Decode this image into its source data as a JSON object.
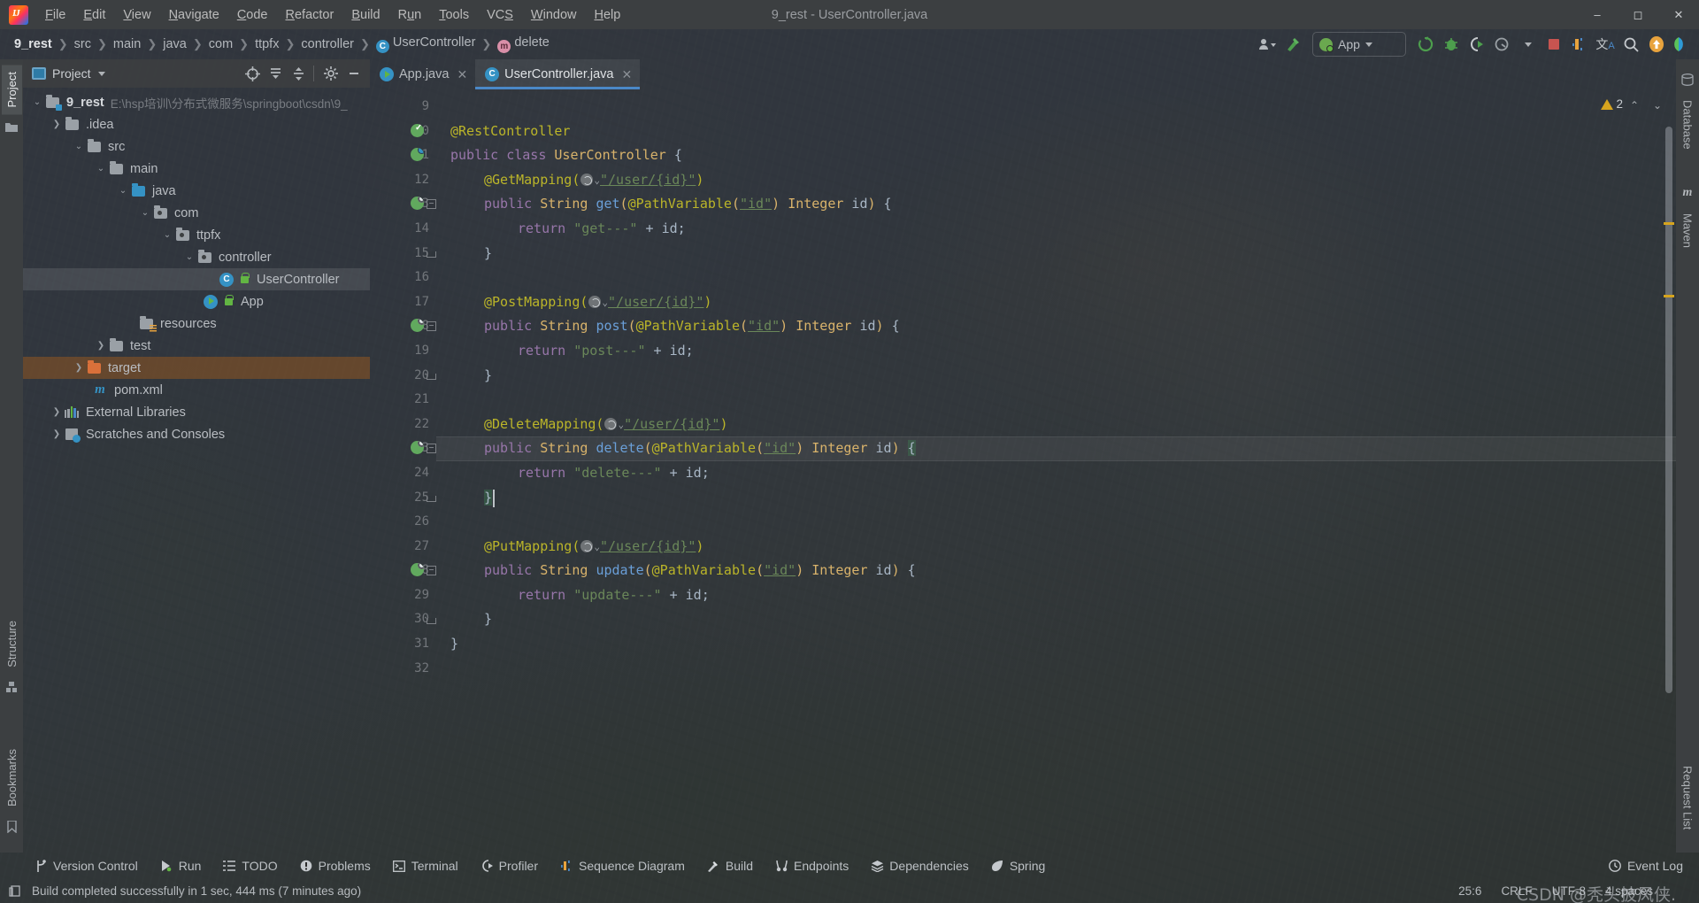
{
  "window": {
    "title": "9_rest - UserController.java",
    "minimize": "‒",
    "maximize": "▢",
    "close": "✕"
  },
  "menu": [
    {
      "label": "File"
    },
    {
      "label": "Edit"
    },
    {
      "label": "View"
    },
    {
      "label": "Navigate"
    },
    {
      "label": "Code"
    },
    {
      "label": "Refactor"
    },
    {
      "label": "Build"
    },
    {
      "label": "Run"
    },
    {
      "label": "Tools"
    },
    {
      "label": "VCS"
    },
    {
      "label": "Window"
    },
    {
      "label": "Help"
    }
  ],
  "breadcrumb": {
    "items": [
      "9_rest",
      "src",
      "main",
      "java",
      "com",
      "ttpfx",
      "controller",
      "UserController",
      "delete"
    ],
    "separator": "❯",
    "class_icon": "C",
    "method_icon": "m"
  },
  "toolbar": {
    "run_config": "App",
    "items": [
      {
        "name": "user-settings",
        "glyph": "👤"
      },
      {
        "name": "build-hammer",
        "glyph": "🔨"
      },
      {
        "name": "rerun",
        "glyph": "⟳"
      },
      {
        "name": "debug",
        "glyph": "🐞"
      },
      {
        "name": "run-with-coverage",
        "glyph": "▶"
      },
      {
        "name": "profiler",
        "glyph": "◑"
      },
      {
        "name": "stop",
        "glyph": "■"
      },
      {
        "name": "sequence-diagram",
        "glyph": "❙"
      },
      {
        "name": "translate",
        "glyph": "文A"
      },
      {
        "name": "search-everywhere",
        "glyph": "🔍"
      },
      {
        "name": "update-available",
        "glyph": "↑"
      },
      {
        "name": "ide-feature",
        "glyph": "◗"
      }
    ]
  },
  "project_panel": {
    "title": "Project",
    "header_buttons": [
      {
        "name": "select-opened-file",
        "glyph": "⊕"
      },
      {
        "name": "expand-all",
        "glyph": "⤓"
      },
      {
        "name": "collapse-all",
        "glyph": "⤒"
      },
      {
        "name": "settings",
        "glyph": "⚙"
      },
      {
        "name": "hide",
        "glyph": "—"
      }
    ],
    "tree": [
      {
        "label": "9_rest",
        "path": "E:\\hsp培训\\分布式微服务\\springboot\\csdn\\9_",
        "indent": 0,
        "arrow": "⌄",
        "icon": "folder-module",
        "bold": true
      },
      {
        "label": ".idea",
        "indent": 1,
        "arrow": "❯",
        "icon": "folder"
      },
      {
        "label": "src",
        "indent": 1,
        "arrow": "⌄",
        "icon": "folder"
      },
      {
        "label": "main",
        "indent": 2,
        "arrow": "⌄",
        "icon": "folder"
      },
      {
        "label": "java",
        "indent": 3,
        "arrow": "⌄",
        "icon": "folder-source"
      },
      {
        "label": "com",
        "indent": 4,
        "arrow": "⌄",
        "icon": "folder-package"
      },
      {
        "label": "ttpfx",
        "indent": 5,
        "arrow": "⌄",
        "icon": "folder-package"
      },
      {
        "label": "controller",
        "indent": 6,
        "arrow": "⌄",
        "icon": "folder-package"
      },
      {
        "label": "UserController",
        "indent": 7,
        "arrow": "",
        "icon": "java-class",
        "selected": true
      },
      {
        "label": "App",
        "indent": 6,
        "arrow": "",
        "icon": "java-runnable-class"
      },
      {
        "label": "resources",
        "indent": 4,
        "arrow": "",
        "icon": "folder-resources"
      },
      {
        "label": "test",
        "indent": 3,
        "arrow": "❯",
        "icon": "folder"
      },
      {
        "label": "target",
        "indent": 1,
        "arrow": "❯",
        "icon": "folder-excluded",
        "target": true
      },
      {
        "label": "pom.xml",
        "indent": 1,
        "arrow": "",
        "icon": "maven"
      },
      {
        "label": "External Libraries",
        "indent": 0,
        "arrow": "❯",
        "icon": "libraries"
      },
      {
        "label": "Scratches and Consoles",
        "indent": 0,
        "arrow": "❯",
        "icon": "scratches"
      }
    ]
  },
  "left_strip": [
    {
      "label": "Project",
      "active": true
    },
    {
      "label": "Structure",
      "active": false
    },
    {
      "label": "Bookmarks",
      "active": false
    }
  ],
  "right_strip": [
    {
      "label": "Database"
    },
    {
      "label": "Maven"
    },
    {
      "label": "Request List"
    }
  ],
  "editor": {
    "tabs": [
      {
        "label": "App.java",
        "icon": "java-runnable-class",
        "active": false,
        "close": "✕"
      },
      {
        "label": "UserController.java",
        "icon": "java-class",
        "active": true,
        "close": "✕"
      }
    ],
    "warning_count": "2",
    "nav_up": "⌃",
    "nav_down": "⌄",
    "first_line_number": 9,
    "lines": [
      {
        "n": 9,
        "text": ""
      },
      {
        "n": 10,
        "text": "@RestController",
        "indent": 0,
        "marker": "bean-check",
        "tokens": [
          {
            "t": "@RestController",
            "c": "an"
          }
        ]
      },
      {
        "n": 11,
        "text": "public class UserController {",
        "indent": 0,
        "marker": "bean-class",
        "tokens": [
          {
            "t": "public",
            "c": "kw"
          },
          {
            "t": " ",
            "c": "op"
          },
          {
            "t": "class",
            "c": "kw"
          },
          {
            "t": " ",
            "c": "op"
          },
          {
            "t": "UserController",
            "c": "ty"
          },
          {
            "t": " {",
            "c": "op"
          }
        ]
      },
      {
        "n": 12,
        "text": "@GetMapping(\"/user/{id}\")",
        "indent": 1,
        "tokens": [
          {
            "t": "@GetMapping(",
            "c": "an"
          },
          {
            "t": "WEB",
            "c": "web"
          },
          {
            "t": "\"/user/{id}\"",
            "c": "st-ul"
          },
          {
            "t": ")",
            "c": "an"
          }
        ]
      },
      {
        "n": 13,
        "text": "public String get(@PathVariable(\"id\") Integer id) {",
        "indent": 1,
        "marker": "bean-web",
        "fold": "collapse",
        "tokens": [
          {
            "t": "public",
            "c": "kw"
          },
          {
            "t": " ",
            "c": "op"
          },
          {
            "t": "String",
            "c": "ty"
          },
          {
            "t": " ",
            "c": "op"
          },
          {
            "t": "get",
            "c": "mn"
          },
          {
            "t": "(",
            "c": "par"
          },
          {
            "t": "@PathVariable",
            "c": "an"
          },
          {
            "t": "(",
            "c": "par"
          },
          {
            "t": "\"id\"",
            "c": "st-ul"
          },
          {
            "t": ")",
            "c": "par"
          },
          {
            "t": " ",
            "c": "op"
          },
          {
            "t": "Integer",
            "c": "ty"
          },
          {
            "t": " id",
            "c": "pn"
          },
          {
            "t": ")",
            "c": "par"
          },
          {
            "t": " {",
            "c": "op"
          }
        ]
      },
      {
        "n": 14,
        "text": "return \"get---\" + id;",
        "indent": 2,
        "tokens": [
          {
            "t": "return",
            "c": "kw"
          },
          {
            "t": " ",
            "c": "op"
          },
          {
            "t": "\"get---\"",
            "c": "st"
          },
          {
            "t": " + ",
            "c": "op"
          },
          {
            "t": "id",
            "c": "pn"
          },
          {
            "t": ";",
            "c": "op"
          }
        ]
      },
      {
        "n": 15,
        "text": "}",
        "indent": 1,
        "fold": "end",
        "tokens": [
          {
            "t": "}",
            "c": "op"
          }
        ]
      },
      {
        "n": 16,
        "text": ""
      },
      {
        "n": 17,
        "text": "@PostMapping(\"/user/{id}\")",
        "indent": 1,
        "tokens": [
          {
            "t": "@PostMapping(",
            "c": "an"
          },
          {
            "t": "WEB",
            "c": "web"
          },
          {
            "t": "\"/user/{id}\"",
            "c": "st-ul"
          },
          {
            "t": ")",
            "c": "an"
          }
        ]
      },
      {
        "n": 18,
        "text": "public String post(@PathVariable(\"id\") Integer id) {",
        "indent": 1,
        "marker": "bean-web",
        "fold": "collapse",
        "tokens": [
          {
            "t": "public",
            "c": "kw"
          },
          {
            "t": " ",
            "c": "op"
          },
          {
            "t": "String",
            "c": "ty"
          },
          {
            "t": " ",
            "c": "op"
          },
          {
            "t": "post",
            "c": "mn"
          },
          {
            "t": "(",
            "c": "par"
          },
          {
            "t": "@PathVariable",
            "c": "an"
          },
          {
            "t": "(",
            "c": "par"
          },
          {
            "t": "\"id\"",
            "c": "st-ul"
          },
          {
            "t": ")",
            "c": "par"
          },
          {
            "t": " ",
            "c": "op"
          },
          {
            "t": "Integer",
            "c": "ty"
          },
          {
            "t": " id",
            "c": "pn"
          },
          {
            "t": ")",
            "c": "par"
          },
          {
            "t": " {",
            "c": "op"
          }
        ]
      },
      {
        "n": 19,
        "text": "return \"post---\" + id;",
        "indent": 2,
        "tokens": [
          {
            "t": "return",
            "c": "kw"
          },
          {
            "t": " ",
            "c": "op"
          },
          {
            "t": "\"post---\"",
            "c": "st"
          },
          {
            "t": " + ",
            "c": "op"
          },
          {
            "t": "id",
            "c": "pn"
          },
          {
            "t": ";",
            "c": "op"
          }
        ]
      },
      {
        "n": 20,
        "text": "}",
        "indent": 1,
        "fold": "end",
        "tokens": [
          {
            "t": "}",
            "c": "op"
          }
        ]
      },
      {
        "n": 21,
        "text": ""
      },
      {
        "n": 22,
        "text": "@DeleteMapping(\"/user/{id}\")",
        "indent": 1,
        "tokens": [
          {
            "t": "@DeleteMapping(",
            "c": "an"
          },
          {
            "t": "WEB",
            "c": "web"
          },
          {
            "t": "\"/user/{id}\"",
            "c": "st-ul"
          },
          {
            "t": ")",
            "c": "an"
          }
        ]
      },
      {
        "n": 23,
        "text": "public String delete(@PathVariable(\"id\") Integer id) {",
        "indent": 1,
        "marker": "bean-web",
        "fold": "collapse",
        "highlight": true,
        "tokens": [
          {
            "t": "public",
            "c": "kw"
          },
          {
            "t": " ",
            "c": "op"
          },
          {
            "t": "String",
            "c": "ty"
          },
          {
            "t": " ",
            "c": "op"
          },
          {
            "t": "delete",
            "c": "mn"
          },
          {
            "t": "(",
            "c": "par"
          },
          {
            "t": "@PathVariable",
            "c": "an"
          },
          {
            "t": "(",
            "c": "par"
          },
          {
            "t": "\"id\"",
            "c": "st-ul"
          },
          {
            "t": ")",
            "c": "par"
          },
          {
            "t": " ",
            "c": "op"
          },
          {
            "t": "Integer",
            "c": "ty"
          },
          {
            "t": " id",
            "c": "pn"
          },
          {
            "t": ")",
            "c": "par"
          },
          {
            "t": " ",
            "c": "op"
          },
          {
            "t": "{",
            "c": "brace"
          }
        ]
      },
      {
        "n": 24,
        "text": "return \"delete---\" + id;",
        "indent": 2,
        "tokens": [
          {
            "t": "return",
            "c": "kw"
          },
          {
            "t": " ",
            "c": "op"
          },
          {
            "t": "\"delete---\"",
            "c": "st"
          },
          {
            "t": " + ",
            "c": "op"
          },
          {
            "t": "id",
            "c": "pn"
          },
          {
            "t": ";",
            "c": "op"
          }
        ]
      },
      {
        "n": 25,
        "text": "}",
        "indent": 1,
        "fold": "end",
        "caret": true,
        "tokens": [
          {
            "t": "}",
            "c": "brace"
          }
        ]
      },
      {
        "n": 26,
        "text": ""
      },
      {
        "n": 27,
        "text": "@PutMapping(\"/user/{id}\")",
        "indent": 1,
        "tokens": [
          {
            "t": "@PutMapping(",
            "c": "an"
          },
          {
            "t": "WEB",
            "c": "web"
          },
          {
            "t": "\"/user/{id}\"",
            "c": "st-ul"
          },
          {
            "t": ")",
            "c": "an"
          }
        ]
      },
      {
        "n": 28,
        "text": "public String update(@PathVariable(\"id\") Integer id) {",
        "indent": 1,
        "marker": "bean-web",
        "fold": "collapse",
        "tokens": [
          {
            "t": "public",
            "c": "kw"
          },
          {
            "t": " ",
            "c": "op"
          },
          {
            "t": "String",
            "c": "ty"
          },
          {
            "t": " ",
            "c": "op"
          },
          {
            "t": "update",
            "c": "mn"
          },
          {
            "t": "(",
            "c": "par"
          },
          {
            "t": "@PathVariable",
            "c": "an"
          },
          {
            "t": "(",
            "c": "par"
          },
          {
            "t": "\"id\"",
            "c": "st-ul"
          },
          {
            "t": ")",
            "c": "par"
          },
          {
            "t": " ",
            "c": "op"
          },
          {
            "t": "Integer",
            "c": "ty"
          },
          {
            "t": " id",
            "c": "pn"
          },
          {
            "t": ")",
            "c": "par"
          },
          {
            "t": " {",
            "c": "op"
          }
        ]
      },
      {
        "n": 29,
        "text": "return \"update---\" + id;",
        "indent": 2,
        "tokens": [
          {
            "t": "return",
            "c": "kw"
          },
          {
            "t": " ",
            "c": "op"
          },
          {
            "t": "\"update---\"",
            "c": "st"
          },
          {
            "t": " + ",
            "c": "op"
          },
          {
            "t": "id",
            "c": "pn"
          },
          {
            "t": ";",
            "c": "op"
          }
        ]
      },
      {
        "n": 30,
        "text": "}",
        "indent": 1,
        "fold": "end",
        "tokens": [
          {
            "t": "}",
            "c": "op"
          }
        ]
      },
      {
        "n": 31,
        "text": "}",
        "indent": 0,
        "tokens": [
          {
            "t": "}",
            "c": "op"
          }
        ]
      },
      {
        "n": 32,
        "text": ""
      }
    ]
  },
  "bottom_tools": [
    {
      "label": "Version Control",
      "icon": "vcs-branch-icon"
    },
    {
      "label": "Run",
      "icon": "run-icon"
    },
    {
      "label": "TODO",
      "icon": "todo-list-icon"
    },
    {
      "label": "Problems",
      "icon": "problems-icon"
    },
    {
      "label": "Terminal",
      "icon": "terminal-icon"
    },
    {
      "label": "Profiler",
      "icon": "profiler-icon"
    },
    {
      "label": "Sequence Diagram",
      "icon": "sequence-diagram-icon"
    },
    {
      "label": "Build",
      "icon": "build-hammer-icon"
    },
    {
      "label": "Endpoints",
      "icon": "endpoints-icon"
    },
    {
      "label": "Dependencies",
      "icon": "dependencies-icon"
    },
    {
      "label": "Spring",
      "icon": "spring-leaf-icon"
    },
    {
      "label": "Event Log",
      "icon": "event-log-icon"
    }
  ],
  "status_bar": {
    "message": "Build completed successfully in 1 sec, 444 ms (7 minutes ago)",
    "caret_position": "25:6",
    "line_separator": "CRLF",
    "encoding": "UTF-8",
    "indent": "4 spaces",
    "watermark": "CSDN @秃头披风侠."
  },
  "colors": {
    "accent": "#4a88c7",
    "annotation": "#bbb529",
    "string": "#6a8759",
    "keyword": "#9876aa",
    "type": "#d9b36b",
    "method": "#6a9fd8",
    "warning": "#d6a41e",
    "run_green": "#62b543"
  }
}
